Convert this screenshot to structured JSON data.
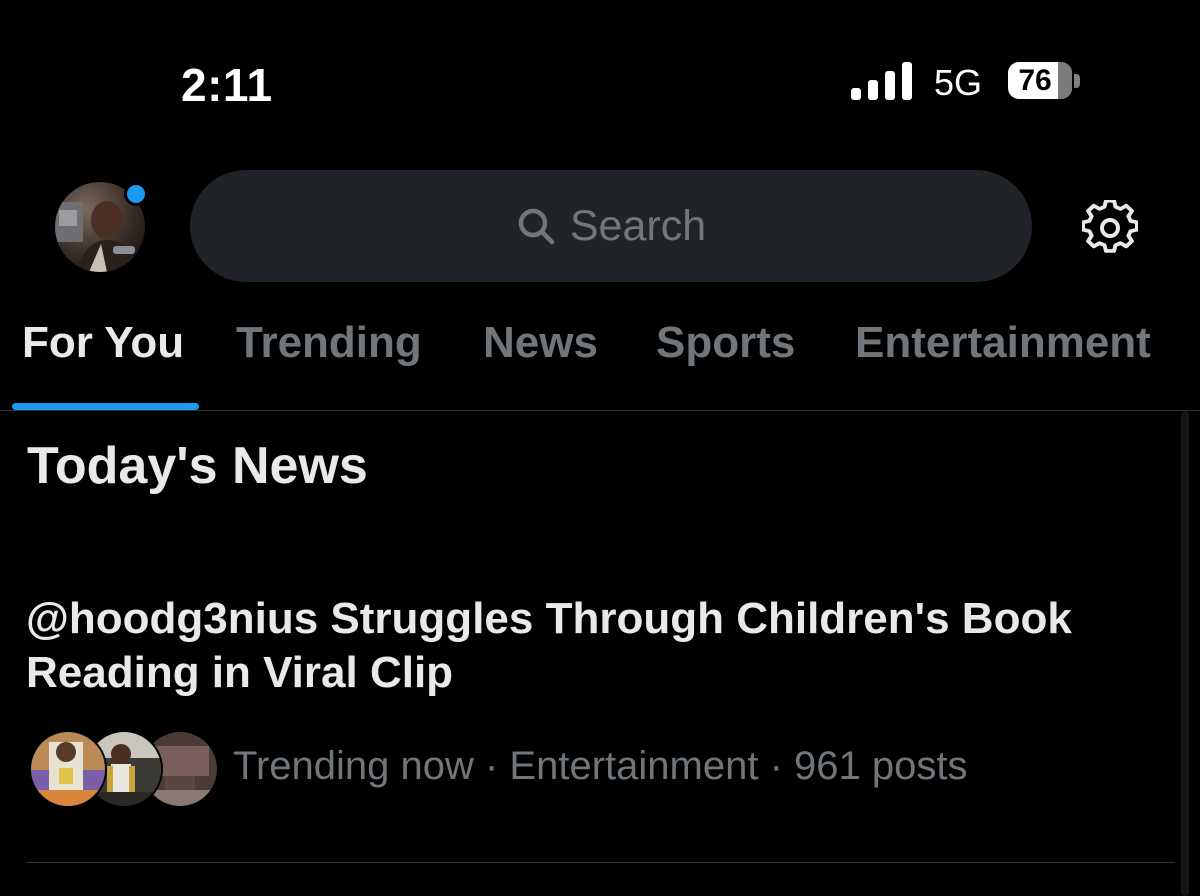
{
  "status_bar": {
    "time": "2:11",
    "network": "5G",
    "battery": "76"
  },
  "header": {
    "avatar_icon": "profile-avatar",
    "notification_dot_color": "#1d9bf0",
    "search_placeholder": "Search",
    "settings_icon": "gear-icon"
  },
  "tabs": [
    {
      "label": "For You",
      "active": true
    },
    {
      "label": "Trending",
      "active": false
    },
    {
      "label": "News",
      "active": false
    },
    {
      "label": "Sports",
      "active": false
    },
    {
      "label": "Entertainment",
      "active": false
    }
  ],
  "section": {
    "title": "Today's News"
  },
  "story": {
    "headline": "@hoodg3nius Struggles Through Children's Book Reading in Viral Clip",
    "meta": "Trending now · Entertainment · 961 posts"
  },
  "colors": {
    "background": "#000000",
    "accent": "#1d9bf0",
    "primary_text": "#e7e9ea",
    "secondary_text": "#71767b"
  }
}
